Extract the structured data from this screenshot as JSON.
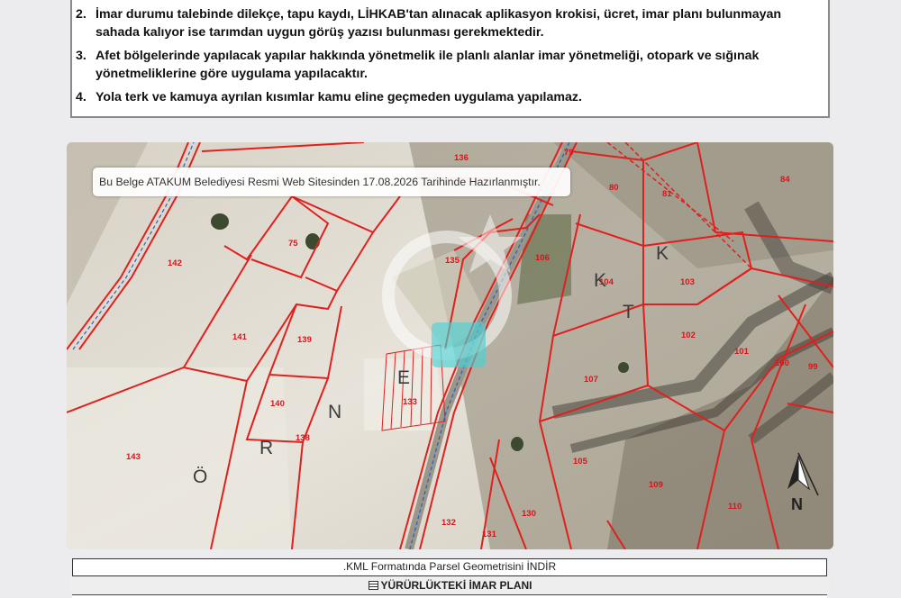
{
  "notes": [
    {
      "num": "2.",
      "text": "İmar durumu talebinde dilekçe, tapu kaydı, LİHKAB'tan alınacak aplikasyon krokisi, ücret, imar planı bulunmayan sahada kalıyor ise tarımdan uygun görüş yazısı bulunması gerekmektedir."
    },
    {
      "num": "3.",
      "text": "Afet bölgelerinde yapılacak yapılar hakkında yönetmelik ile planlı alanlar imar yönetmeliği, otopark ve sığınak yönetmeliklerine göre uygulama yapılacaktır."
    },
    {
      "num": "4.",
      "text": "Yola terk ve kamuya ayrılan kısımlar kamu eline geçmeden uygulama yapılamaz."
    }
  ],
  "map": {
    "stamp_text": "Bu Belge ATAKUM Belediyesi Resmi Web Sitesinden 17.08.2026 Tarihinde Hazırlanmıştır.",
    "parcels": [
      "136",
      "79",
      "80",
      "81",
      "84",
      "75",
      "142",
      "135",
      "106",
      "104",
      "103",
      "141",
      "139",
      "102",
      "101",
      "100",
      "99",
      "107",
      "140",
      "133",
      "138",
      "143",
      "105",
      "109",
      "110",
      "132",
      "131",
      "130"
    ],
    "place_letters": [
      "Ö",
      "R",
      "N",
      "E",
      "K",
      "T",
      "K"
    ],
    "compass_label": "N",
    "watermark": "GB"
  },
  "links": {
    "kml_download": ".KML Formatında Parsel Geometrisini İNDİR",
    "plan_header": "YÜRÜRLÜKTEKİ İMAR PLANI"
  }
}
